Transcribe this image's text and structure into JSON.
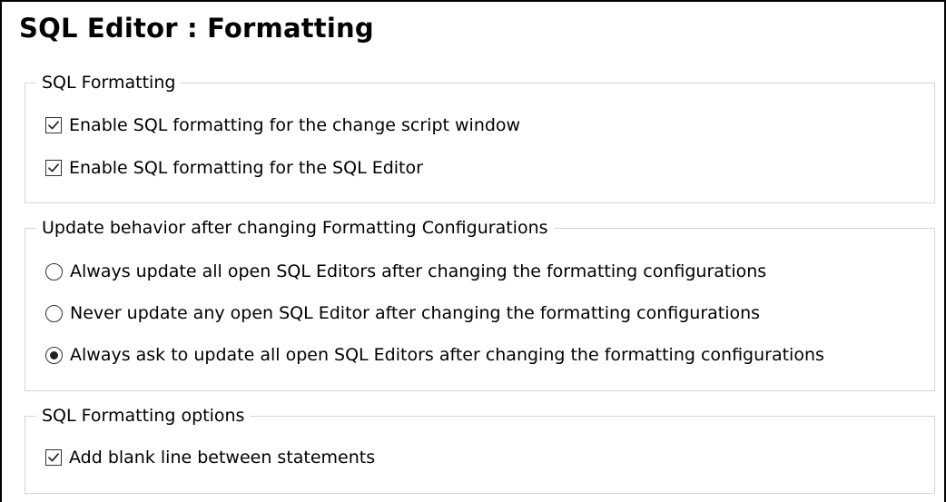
{
  "page": {
    "title": "SQL Editor : Formatting"
  },
  "groups": {
    "sql_formatting": {
      "legend": "SQL Formatting",
      "options": [
        {
          "label": "Enable SQL formatting for the change script window",
          "checked": true
        },
        {
          "label": "Enable SQL formatting for the SQL Editor",
          "checked": true
        }
      ]
    },
    "update_behavior": {
      "legend": "Update behavior after changing Formatting Configurations",
      "options": [
        {
          "label": "Always update all open SQL Editors after changing the formatting configurations",
          "selected": false
        },
        {
          "label": "Never update any open SQL Editor after changing the formatting configurations",
          "selected": false
        },
        {
          "label": "Always ask to update all open SQL Editors after changing the formatting configurations",
          "selected": true
        }
      ]
    },
    "formatting_options": {
      "legend": "SQL Formatting options",
      "options": [
        {
          "label": "Add blank line between statements",
          "checked": true
        }
      ]
    }
  }
}
